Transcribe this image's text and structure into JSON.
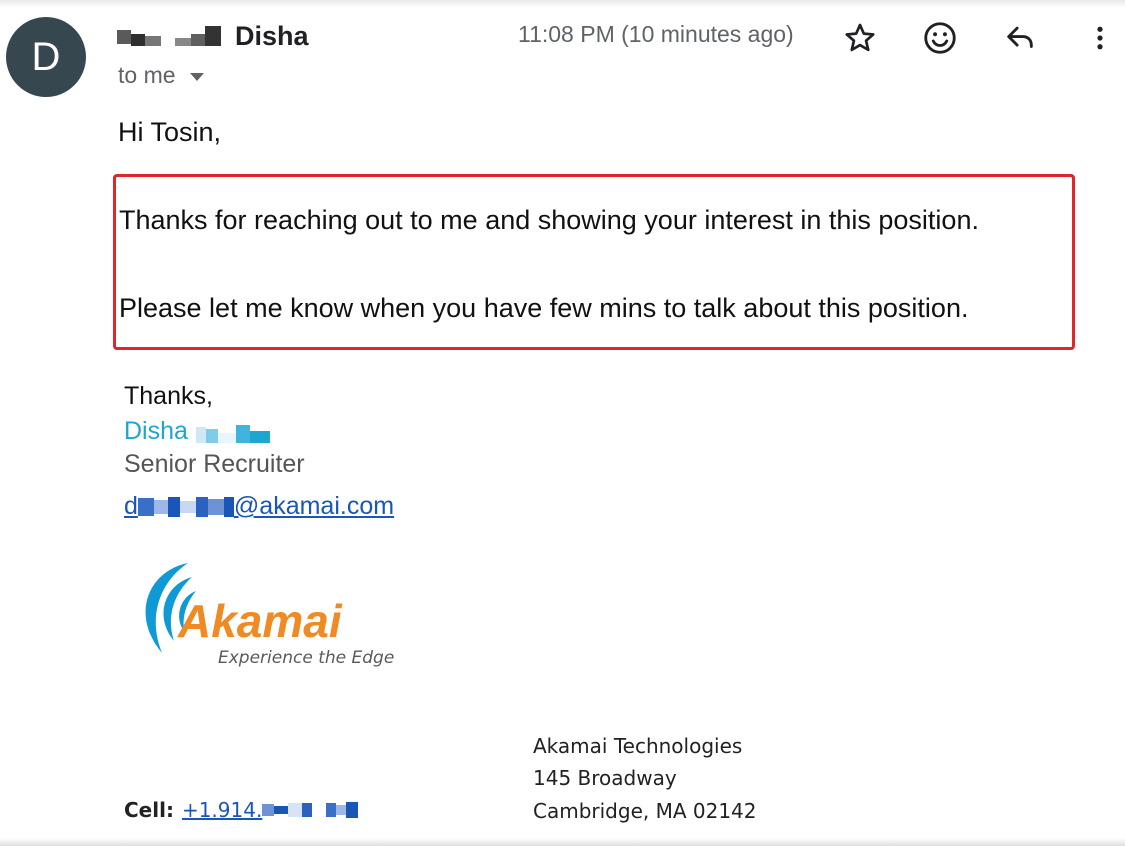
{
  "email": {
    "avatar_letter": "D",
    "sender_name": "Disha",
    "timestamp": "11:08 PM (10 minutes ago)",
    "recipient_label": "to me",
    "greeting": "Hi Tosin,",
    "body_lines": [
      "Thanks for reaching out to me and showing your interest in this position.",
      "Please let me know when you have few mins to talk about this position."
    ],
    "actions": {
      "star_icon": "star-icon",
      "emoji_icon": "emoji-icon",
      "reply_icon": "reply-icon",
      "more_icon": "more-options-icon"
    }
  },
  "signature": {
    "closing": "Thanks,",
    "name": "Disha",
    "title": "Senior Recruiter",
    "email_prefix": "d",
    "email_domain": "@akamai.com",
    "logo": {
      "wordmark": "Akamai",
      "tagline": "Experience the Edge"
    },
    "company": "Akamai Technologies",
    "address_line1": "145 Broadway",
    "address_line2": "Cambridge, MA 02142",
    "cell_label": "Cell:",
    "cell_number": "+1.914."
  },
  "colors": {
    "highlight_border": "#e0262b",
    "link": "#1a55b8",
    "name_accent": "#1fa6d0",
    "logo_orange": "#f08a24",
    "logo_blue": "#0f9ad6"
  }
}
